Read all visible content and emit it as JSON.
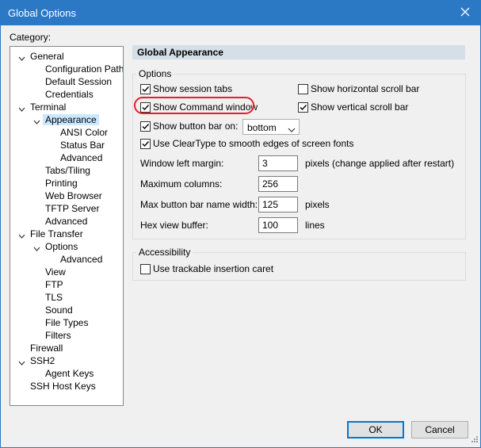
{
  "window": {
    "title": "Global Options"
  },
  "category": {
    "label": "Category:",
    "items": [
      {
        "label": "General",
        "expanded": true
      },
      {
        "label": "Configuration Paths"
      },
      {
        "label": "Default Session"
      },
      {
        "label": "Credentials"
      },
      {
        "label": "Terminal",
        "expanded": true
      },
      {
        "label": "Appearance",
        "expanded": true,
        "selected": true
      },
      {
        "label": "ANSI Color"
      },
      {
        "label": "Status Bar"
      },
      {
        "label": "Advanced"
      },
      {
        "label": "Tabs/Tiling"
      },
      {
        "label": "Printing"
      },
      {
        "label": "Web Browser"
      },
      {
        "label": "TFTP Server"
      },
      {
        "label": "Advanced"
      },
      {
        "label": "File Transfer",
        "expanded": true
      },
      {
        "label": "Options",
        "expanded": true
      },
      {
        "label": "Advanced"
      },
      {
        "label": "View"
      },
      {
        "label": "FTP"
      },
      {
        "label": "TLS"
      },
      {
        "label": "Sound"
      },
      {
        "label": "File Types"
      },
      {
        "label": "Filters"
      },
      {
        "label": "Firewall"
      },
      {
        "label": "SSH2",
        "expanded": true
      },
      {
        "label": "Agent Keys"
      },
      {
        "label": "SSH Host Keys"
      }
    ]
  },
  "section": {
    "title": "Global Appearance"
  },
  "options": {
    "label": "Options",
    "show_session_tabs": {
      "label": "Show session tabs",
      "checked": true
    },
    "show_horizontal_scroll": {
      "label": "Show horizontal scroll bar",
      "checked": false
    },
    "show_command_window": {
      "label": "Show Command window",
      "checked": true
    },
    "show_vertical_scroll": {
      "label": "Show vertical scroll bar",
      "checked": true
    },
    "show_button_bar": {
      "label": "Show button bar on:",
      "checked": true,
      "position": "bottom"
    },
    "use_cleartype": {
      "label": "Use ClearType to smooth edges of screen fonts",
      "checked": true
    },
    "window_left_margin": {
      "label": "Window left margin:",
      "value": "3",
      "unit": "pixels (change applied after restart)"
    },
    "maximum_columns": {
      "label": "Maximum columns:",
      "value": "256"
    },
    "max_button_bar_name_width": {
      "label": "Max button bar name width:",
      "value": "125",
      "unit": "pixels"
    },
    "hex_view_buffer": {
      "label": "Hex view buffer:",
      "value": "100",
      "unit": "lines"
    }
  },
  "accessibility": {
    "label": "Accessibility",
    "trackable_caret": {
      "label": "Use trackable insertion caret",
      "checked": false
    }
  },
  "buttons": {
    "ok": "OK",
    "cancel": "Cancel"
  },
  "colors": {
    "title_bar": "#2b78c5",
    "highlight_ring": "#e3202b",
    "selection": "#cce8ff"
  }
}
